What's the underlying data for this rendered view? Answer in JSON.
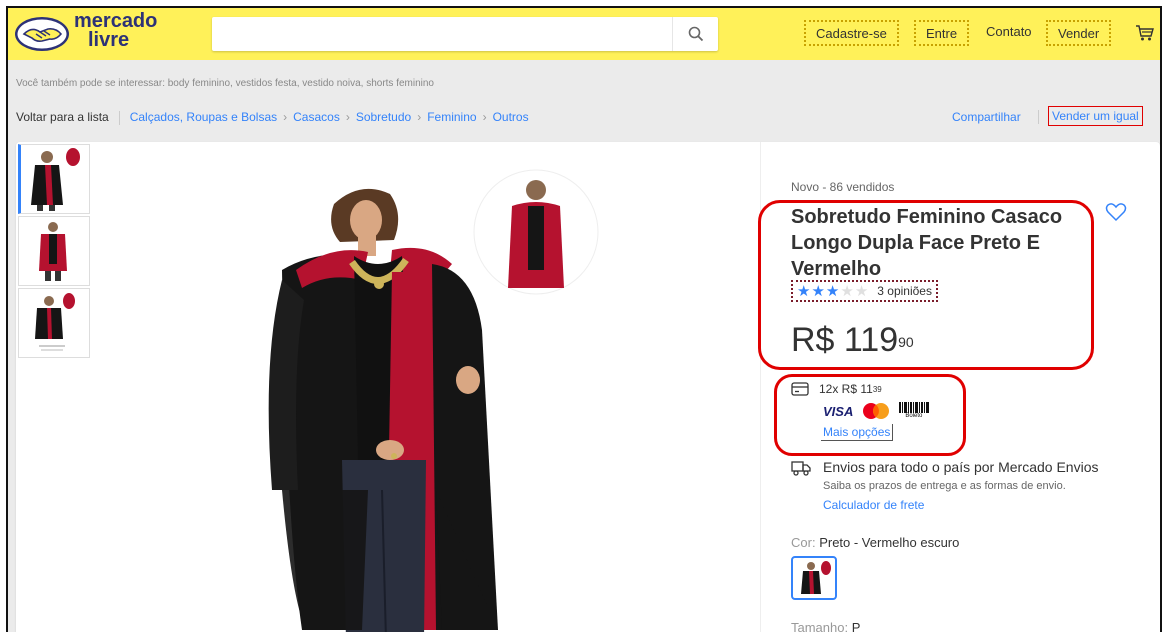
{
  "header": {
    "logo_line1": "mercado",
    "logo_line2": "livre",
    "search_placeholder": "",
    "nav": [
      "Cadastre-se",
      "Entre",
      "Contato",
      "Vender"
    ]
  },
  "suggestions": "Você também pode se interessar: body feminino, vestidos festa, vestido noiva, shorts feminino",
  "breadcrumb": {
    "back": "Voltar para a lista",
    "items": [
      "Calçados, Roupas e Bolsas",
      "Casacos",
      "Sobretudo",
      "Feminino",
      "Outros"
    ],
    "share": "Compartilhar",
    "sell_same": "Vender um igual"
  },
  "product": {
    "condition": "Novo - 86 vendidos",
    "title": "Sobretudo Feminino Casaco Longo Dupla Face Preto E Vermelho",
    "rating_stars": 3,
    "rating_max": 5,
    "rating_count": "3 opiniões",
    "price_currency": "R$",
    "price_int": "119",
    "price_cents": "90",
    "installment_text": "12x R$ 11",
    "installment_cents": "39",
    "payment_visa": "VISA",
    "payment_boleto": "Boleto",
    "more_options": "Mais opções",
    "shipping_title": "Envios para todo o país por Mercado Envios",
    "shipping_sub": "Saiba os prazos de entrega e as formas de envio.",
    "shipping_link": "Calculador de frete",
    "color_label": "Cor:",
    "color_value": "Preto - Vermelho escuro",
    "size_label": "Tamanho:",
    "size_value": "P"
  },
  "colors": {
    "header_bg": "#fff159",
    "link": "#3483fa",
    "annotation": "#e00000",
    "coat_black": "#151515",
    "coat_red": "#b5122f"
  }
}
